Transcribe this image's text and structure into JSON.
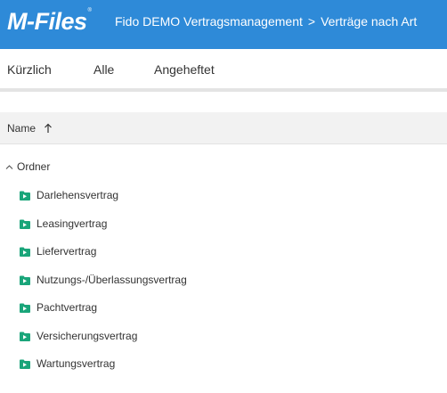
{
  "header": {
    "logo": "M-Files",
    "logo_mark": "®",
    "breadcrumb": [
      "Fido DEMO Vertragsmanagement",
      "Verträge nach Art"
    ],
    "breadcrumb_separator": ">",
    "background": "#2e8ad8"
  },
  "tabs": [
    "Kürzlich",
    "Alle",
    "Angeheftet"
  ],
  "column_header": {
    "label": "Name",
    "sort_icon": "arrow-up-icon"
  },
  "group": {
    "label": "Ordner",
    "icon": "chevron-up-icon"
  },
  "items": [
    {
      "label": "Darlehensvertrag",
      "icon": "view-folder-icon"
    },
    {
      "label": "Leasingvertrag",
      "icon": "view-folder-icon"
    },
    {
      "label": "Liefervertrag",
      "icon": "view-folder-icon"
    },
    {
      "label": "Nutzungs-/Überlassungsvertrag",
      "icon": "view-folder-icon"
    },
    {
      "label": "Pachtvertrag",
      "icon": "view-folder-icon"
    },
    {
      "label": "Versicherungsvertrag",
      "icon": "view-folder-icon"
    },
    {
      "label": "Wartungsvertrag",
      "icon": "view-folder-icon"
    }
  ],
  "colors": {
    "icon_green": "#1aa57a",
    "accent_blue": "#2e8ad8"
  }
}
